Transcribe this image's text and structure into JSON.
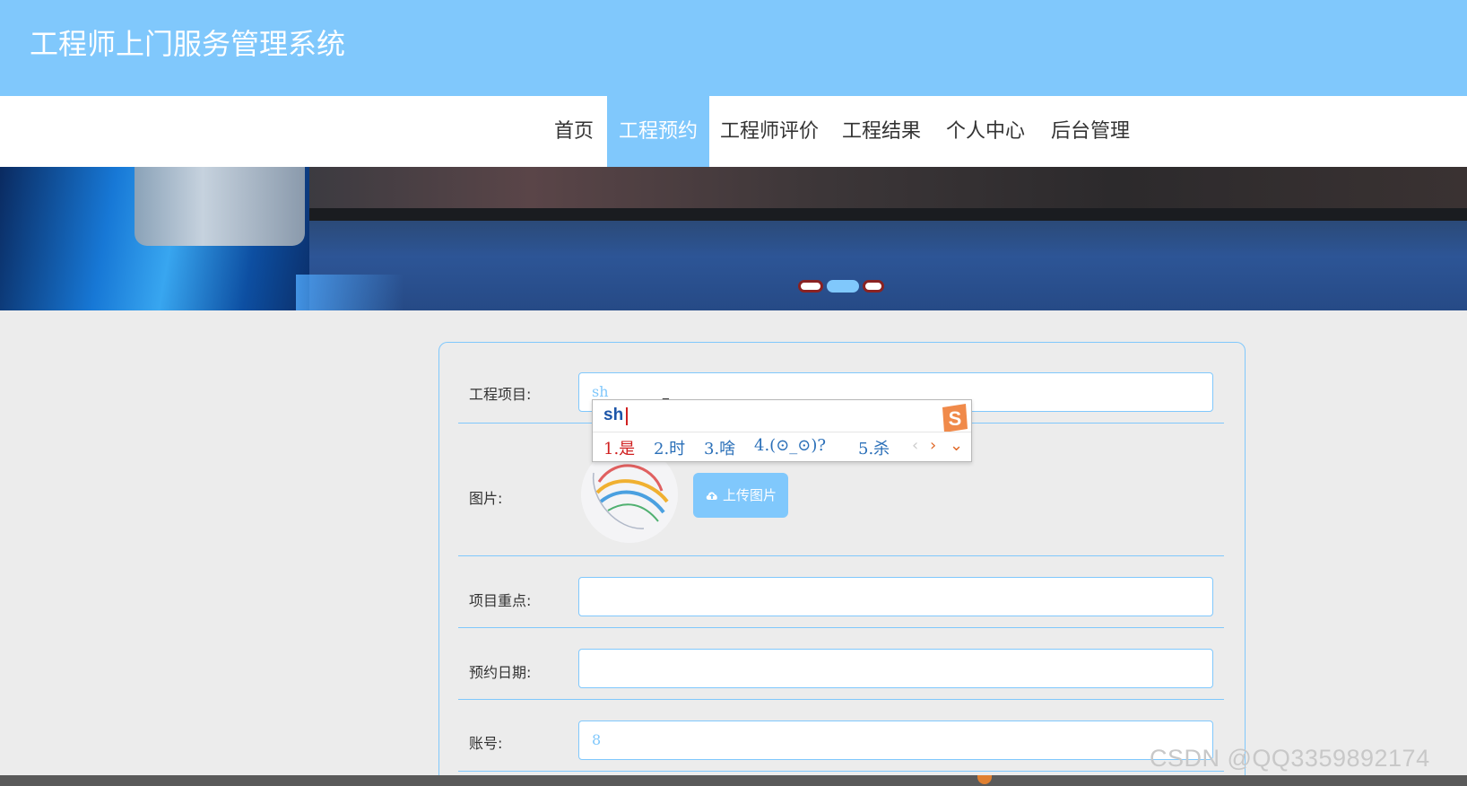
{
  "header": {
    "title": "工程师上门服务管理系统"
  },
  "nav": {
    "items": [
      {
        "label": "首页"
      },
      {
        "label": "工程预约"
      },
      {
        "label": "工程师评价"
      },
      {
        "label": "工程结果"
      },
      {
        "label": "个人中心"
      },
      {
        "label": "后台管理"
      }
    ],
    "active_index": 1
  },
  "banner": {
    "slide_count": 3,
    "active_slide": 2
  },
  "form": {
    "project": {
      "label": "工程项目:",
      "value": "sh"
    },
    "image": {
      "label": "图片:",
      "upload_label": "上传图片"
    },
    "focus": {
      "label": "项目重点:",
      "value": ""
    },
    "date": {
      "label": "预约日期:",
      "value": ""
    },
    "account": {
      "label": "账号:",
      "value": "8"
    }
  },
  "ime": {
    "input": "sh",
    "candidates": [
      "1.是",
      "2.时",
      "3.啥",
      "4.(⊙_⊙)?",
      "5.杀"
    ],
    "logo": "S"
  },
  "watermark": "CSDN @QQ3359892174",
  "colors": {
    "primary": "#80c8fc",
    "background": "#ececec",
    "ime_first": "#d02020",
    "ime_candidate": "#2a6fb8",
    "ime_logo": "#f08a4a"
  }
}
